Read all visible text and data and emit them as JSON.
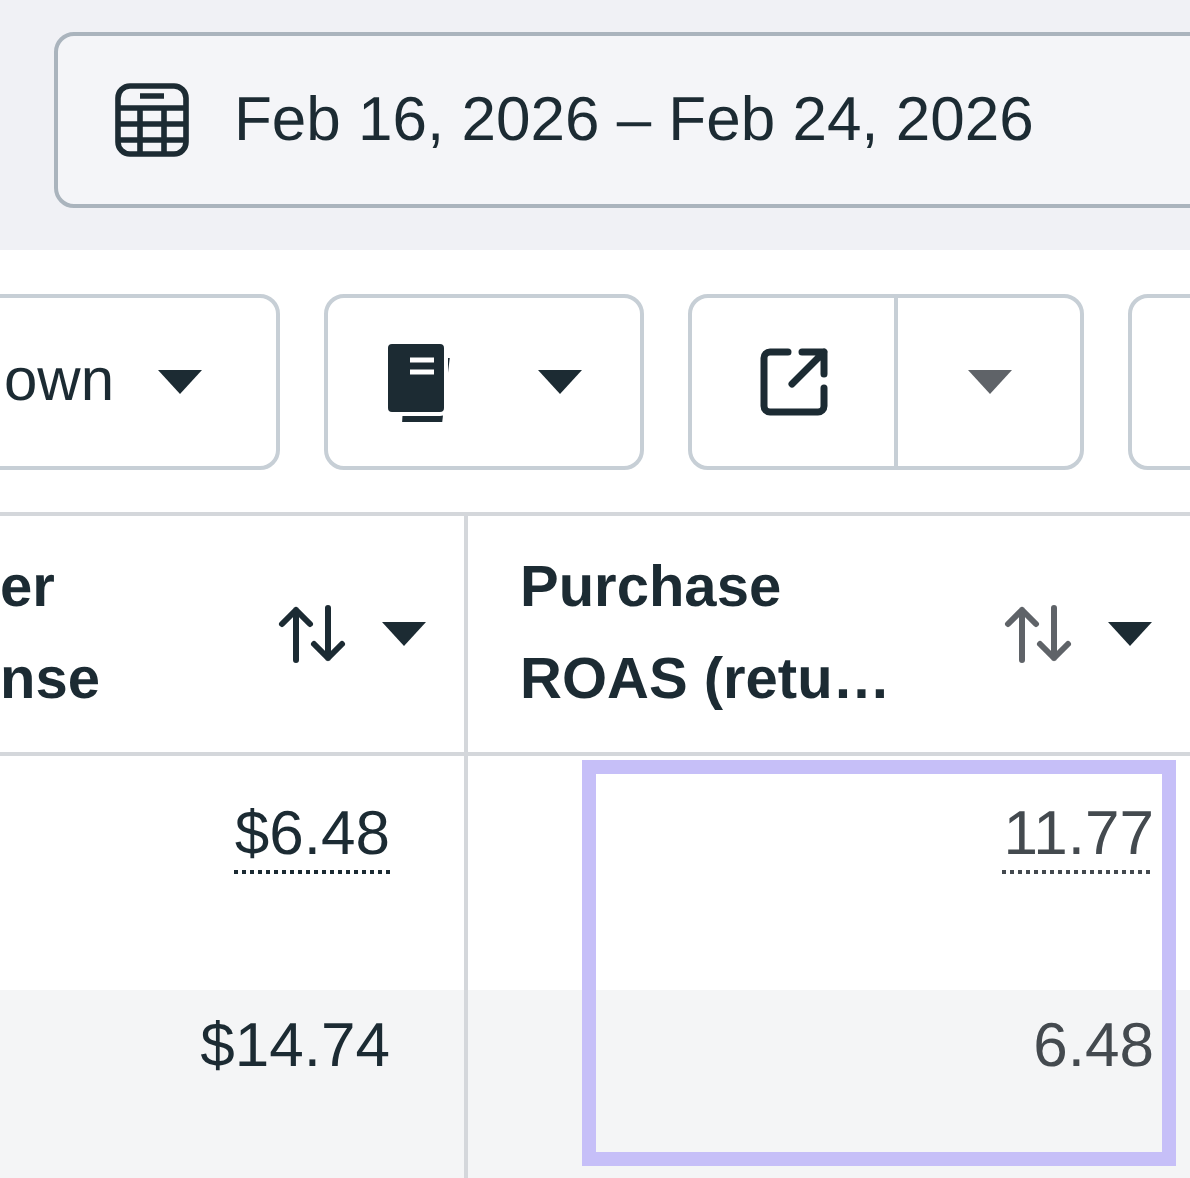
{
  "date_range": {
    "label": "Feb 16, 2026 – Feb 24, 2026"
  },
  "toolbar": [
    {
      "kind": "text-dropdown",
      "label": "own"
    },
    {
      "kind": "icon-dropdown"
    },
    {
      "kind": "split"
    },
    {
      "kind": "stub"
    }
  ],
  "table": {
    "columns": [
      {
        "label_lines": [
          "er",
          "nse"
        ]
      },
      {
        "label_lines": [
          "Purchase",
          "ROAS (retu…"
        ]
      }
    ],
    "rows": [
      {
        "cells": [
          {
            "value": "$6.48",
            "dotted": true,
            "highlighted": false
          },
          {
            "value": "11.77",
            "dotted": true,
            "highlighted": true
          }
        ]
      },
      {
        "cells": [
          {
            "value": "$14.74",
            "dotted": false,
            "highlighted": false
          },
          {
            "value": "6.48",
            "dotted": false,
            "highlighted": true
          }
        ]
      }
    ]
  }
}
